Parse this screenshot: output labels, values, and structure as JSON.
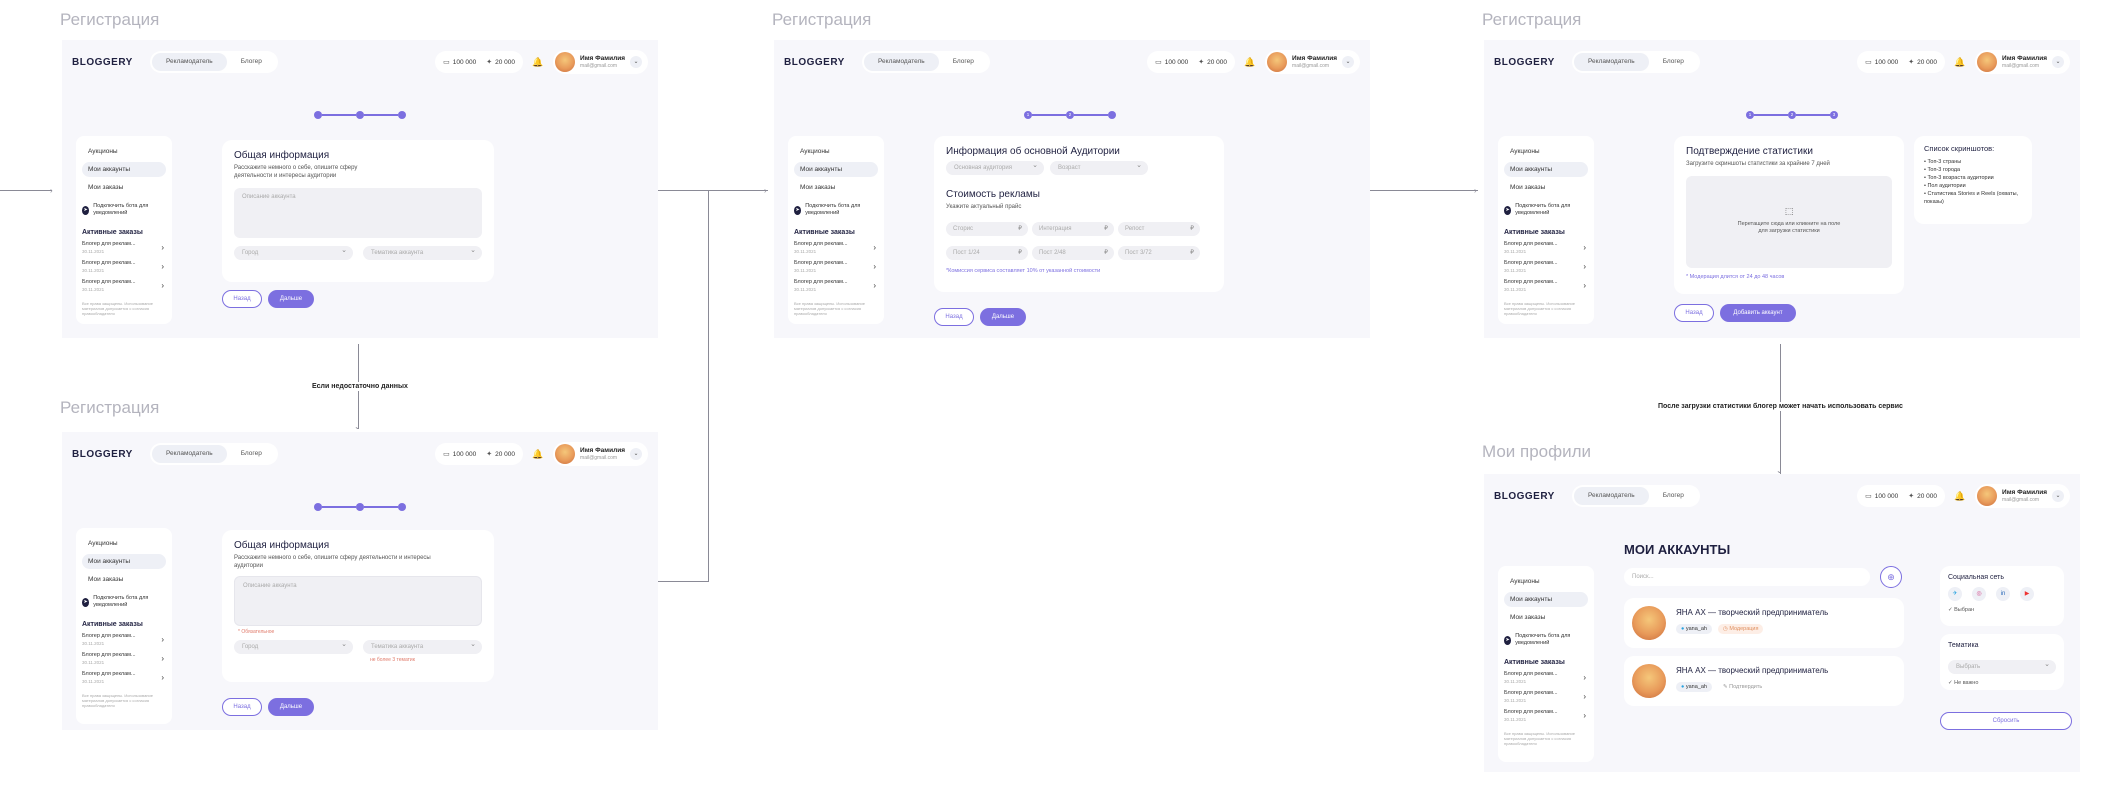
{
  "titles": {
    "reg": "Регистрация",
    "profiles": "Мои профили"
  },
  "header": {
    "logo": "BLOGGERY",
    "tab_advertiser": "Рекламодатель",
    "tab_blogger": "Блогер",
    "balance": "100 000",
    "bonus": "20 000",
    "user_name": "Имя Фамилия",
    "user_email": "mail@gmail.com"
  },
  "sidebar": {
    "items": [
      "Аукционы",
      "Мои аккаунты",
      "Мои заказы"
    ],
    "telegram": "Подключить бота для уведомлений",
    "active_orders_title": "Активные заказы",
    "orders": [
      {
        "title": "Блогер для реклам...",
        "date": "30.11.2021"
      },
      {
        "title": "Блогер для реклам...",
        "date": "30.11.2021"
      },
      {
        "title": "Блогер для реклам...",
        "date": "30.11.2021"
      }
    ],
    "footer": "Все права защищены. Использование материалов допускается с согласия правообладателя"
  },
  "step1": {
    "title": "Общая информация",
    "subtitle": "Расскажите немного о себе, опишите сферу деятельности и интересы аудитории",
    "desc_placeholder": "Описание аккаунта",
    "country_placeholder": "Город",
    "topic_placeholder": "Тематика аккаунта",
    "required": "* Обязательное",
    "topic_hint": "не более 3 тематик"
  },
  "step2": {
    "audience_title": "Информация об основной Аудитории",
    "audience_sel1": "Основная аудитория",
    "audience_sel2": "Возраст",
    "price_title": "Стоимость рекламы",
    "price_sub": "Укажите актуальный прайс",
    "prices": [
      {
        "label": "Сторис",
        "unit": "₽"
      },
      {
        "label": "Интеграция",
        "unit": "₽"
      },
      {
        "label": "Репост",
        "unit": "₽"
      },
      {
        "label": "Пост 1/24",
        "unit": "₽"
      },
      {
        "label": "Пост 2/48",
        "unit": "₽"
      },
      {
        "label": "Пост 3/72",
        "unit": "₽"
      }
    ],
    "note": "*Комиссия сервиса составляет 10% от указанной стоимости"
  },
  "step3": {
    "title": "Подтверждение статистики",
    "subtitle": "Загрузите скриншоты статистики за крайние 7 дней",
    "drop_text": "Перетащите сюда или кликните на поле для загрузки статистики",
    "note": "* Модерация длится от 24 до 48 часов",
    "list_title": "Список скриншотов:",
    "list": [
      "Топ-3 страны",
      "Топ-3 города",
      "Топ-3 возраста аудитории",
      "Пол аудитории",
      "Статистика Stories и Reels (охваты, показы)"
    ],
    "add_button": "Добавить аккаунт"
  },
  "buttons": {
    "back": "Назад",
    "next": "Дальше"
  },
  "flow": {
    "insufficient": "Если недостаточно данных",
    "after_upload": "После загрузки статистики блогер может начать использовать сервис"
  },
  "accounts": {
    "title": "МОИ АККАУНТЫ",
    "search_placeholder": "Поиск...",
    "items": [
      {
        "name": "ЯНА АХ — творческий предприниматель",
        "handle": "yana_ah",
        "status": "Модерация"
      },
      {
        "name": "ЯНА АХ — творческий предприниматель",
        "handle": "yana_ah",
        "status": "Подтвердить"
      }
    ],
    "filter_social_title": "Социальная сеть",
    "filter_selected": "Выбран",
    "filter_topic_title": "Тематика",
    "filter_topic_placeholder": "Выбрать",
    "filter_none": "Не важно",
    "reset": "Сбросить"
  },
  "colors": {
    "accent": "#7c6fe0",
    "bg": "#f7f7fb"
  }
}
